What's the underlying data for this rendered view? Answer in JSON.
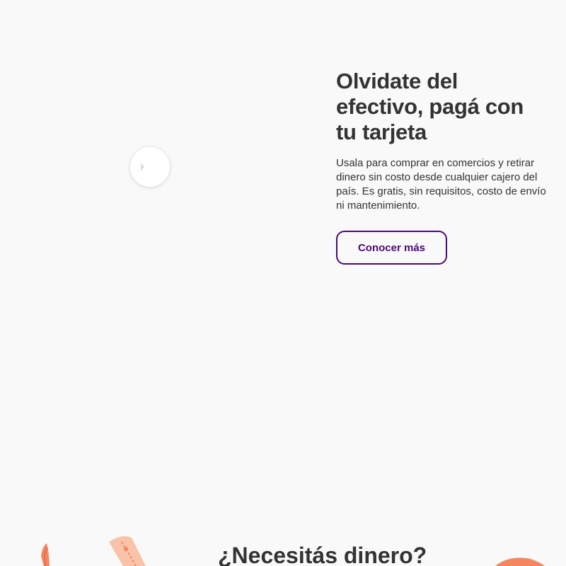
{
  "hero": {
    "title": "Olvidate del efectivo, pagá con tu tarjeta",
    "description": "Usala para comprar en comercios y retirar dinero sin costo desde cualquier cajero del país. Es gratis, sin requisitos, costo de envío ni mantenimiento.",
    "cta_label": "Conocer más"
  },
  "video": {
    "play_icon": "play-icon"
  },
  "next_section": {
    "title": "¿Necesitás dinero?"
  },
  "colors": {
    "background": "#f9f9f9",
    "text": "#333333",
    "accent_purple": "#4a0a77",
    "illustration_orange": "#f4875f"
  }
}
